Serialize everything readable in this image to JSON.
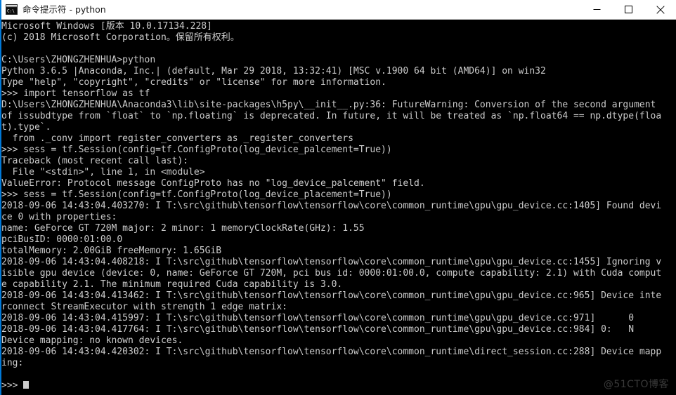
{
  "window": {
    "title": "命令提示符 - python",
    "icon": "console-icon",
    "accent_color": "#0078d7",
    "titlebar_bg": "#ffffff",
    "console_bg": "#000000",
    "console_fg": "#cccccc",
    "controls": {
      "minimize_label": "最小化",
      "maximize_label": "最大化",
      "close_label": "关闭"
    }
  },
  "watermark": {
    "text": "@51CTO博客"
  },
  "console": {
    "lines": [
      "Microsoft Windows [版本 10.0.17134.228]",
      "(c) 2018 Microsoft Corporation。保留所有权利。",
      "",
      "C:\\Users\\ZHONGZHENHUA>python",
      "Python 3.6.5 |Anaconda, Inc.| (default, Mar 29 2018, 13:32:41) [MSC v.1900 64 bit (AMD64)] on win32",
      "Type \"help\", \"copyright\", \"credits\" or \"license\" for more information.",
      ">>> import tensorflow as tf",
      "D:\\Users\\ZHONGZHENHUA\\Anaconda3\\lib\\site-packages\\h5py\\__init__.py:36: FutureWarning: Conversion of the second argument",
      "of issubdtype from `float` to `np.floating` is deprecated. In future, it will be treated as `np.float64 == np.dtype(floa",
      "t).type`.",
      "  from ._conv import register_converters as _register_converters",
      ">>> sess = tf.Session(config=tf.ConfigProto(log_device_palcement=True))",
      "Traceback (most recent call last):",
      "  File \"<stdin>\", line 1, in <module>",
      "ValueError: Protocol message ConfigProto has no \"log_device_palcement\" field.",
      ">>> sess = tf.Session(config=tf.ConfigProto(log_device_placement=True))",
      "2018-09-06 14:43:04.403270: I T:\\src\\github\\tensorflow\\tensorflow\\core\\common_runtime\\gpu\\gpu_device.cc:1405] Found devi",
      "ce 0 with properties:",
      "name: GeForce GT 720M major: 2 minor: 1 memoryClockRate(GHz): 1.55",
      "pciBusID: 0000:01:00.0",
      "totalMemory: 2.00GiB freeMemory: 1.65GiB",
      "2018-09-06 14:43:04.408218: I T:\\src\\github\\tensorflow\\tensorflow\\core\\common_runtime\\gpu\\gpu_device.cc:1455] Ignoring v",
      "isible gpu device (device: 0, name: GeForce GT 720M, pci bus id: 0000:01:00.0, compute capability: 2.1) with Cuda comput",
      "e capability 2.1. The minimum required Cuda capability is 3.0.",
      "2018-09-06 14:43:04.413462: I T:\\src\\github\\tensorflow\\tensorflow\\core\\common_runtime\\gpu\\gpu_device.cc:965] Device inte",
      "rconnect StreamExecutor with strength 1 edge matrix:",
      "2018-09-06 14:43:04.415997: I T:\\src\\github\\tensorflow\\tensorflow\\core\\common_runtime\\gpu\\gpu_device.cc:971]      0",
      "2018-09-06 14:43:04.417764: I T:\\src\\github\\tensorflow\\tensorflow\\core\\common_runtime\\gpu\\gpu_device.cc:984] 0:   N",
      "Device mapping: no known devices.",
      "2018-09-06 14:43:04.420302: I T:\\src\\github\\tensorflow\\tensorflow\\core\\common_runtime\\direct_session.cc:288] Device mapp",
      "ing:",
      "",
      ">>> "
    ],
    "prompt_symbol": ">>>",
    "cursor_visible": true
  }
}
